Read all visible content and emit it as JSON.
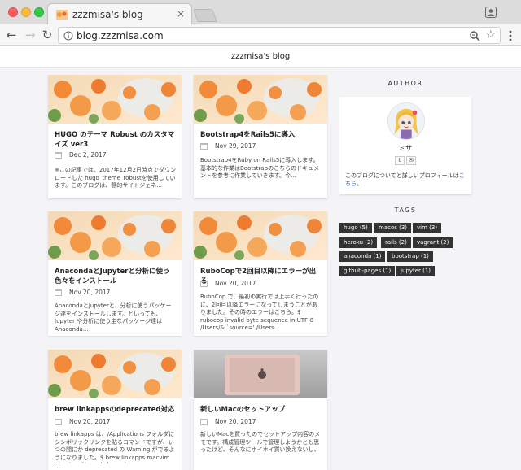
{
  "browser": {
    "tab_title": "zzzmisa's blog",
    "tab_close": "×",
    "url": "blog.zzzmisa.com",
    "back": "←",
    "forward": "→",
    "reload": "↻",
    "star": "☆"
  },
  "site": {
    "title": "zzzmisa's blog"
  },
  "posts": [
    {
      "title": "HUGO のテーマ Robust のカスタマイズ ver3",
      "date": "Dec 2, 2017",
      "excerpt": "※この記事では、2017年12月2日時点でダウンロードした hugo_theme_robustを使用しています。このブログは、静的サイトジェネ...",
      "thumb": "flowers"
    },
    {
      "title": "Bootstrap4をRails5に導入",
      "date": "Nov 29, 2017",
      "excerpt": "Bootstrap4をRuby on Rails5に導入します。基本的な作業はBootstrapのこちらのドキュメントを参考に作業していきます。今...",
      "thumb": "flowers"
    },
    {
      "title": "AnacondaとJupyterと分析に使う色々をインストール",
      "date": "Nov 20, 2017",
      "excerpt": "AnacondaとJupyterと、分析に使うパッケージ達をインストールします。といっても、Jupyter や分析に使う主なパッケージ達はAnaconda...",
      "thumb": "flowers"
    },
    {
      "title": "RuboCopで2回目以降にエラーが出る",
      "date": "Nov 20, 2017",
      "excerpt": "RuboCop で、最初の実行では上手く行ったのに、2回目以降エラーになってしまうことがありました。その時のエラーはこちら。$ rubocop invalid byte sequence in UTF-8 /Users/& `source=' /Users...",
      "thumb": "flowers"
    },
    {
      "title": "brew linkappsのdeprecated対応",
      "date": "Nov 20, 2017",
      "excerpt": "brew linkapps は、/Applications フォルダにシンボリックリンクを貼るコマンドですが、いつの間にか deprecated の Warning がでるようになりました。$ brew linkapps macvim Warning: `brew linkapps`...",
      "thumb": "flowers"
    },
    {
      "title": "新しいMacのセットアップ",
      "date": "Nov 20, 2017",
      "excerpt": "新しいMacを買ったのでセットアップ内容のメモです。構成管理ツールで管理しようかとも思ったけど、そんなにホイホイ買い換えないし、自分用にメ...",
      "thumb": "macbook"
    }
  ],
  "sidebar": {
    "author_heading": "AUTHOR",
    "author_name": "ミサ",
    "author_desc": "このブログについてと詳しいプロフィールは",
    "author_link": "こちら",
    "author_desc_end": "。",
    "twitter": "t",
    "mail": "✉",
    "tags_heading": "TAGS",
    "tags": [
      "hugo (5)",
      "macos (3)",
      "vim (3)",
      "heroku (2)",
      "rails (2)",
      "vagrant (2)",
      "anaconda (1)",
      "bootstrap (1)",
      "github-pages (1)",
      "jupyter (1)"
    ]
  }
}
